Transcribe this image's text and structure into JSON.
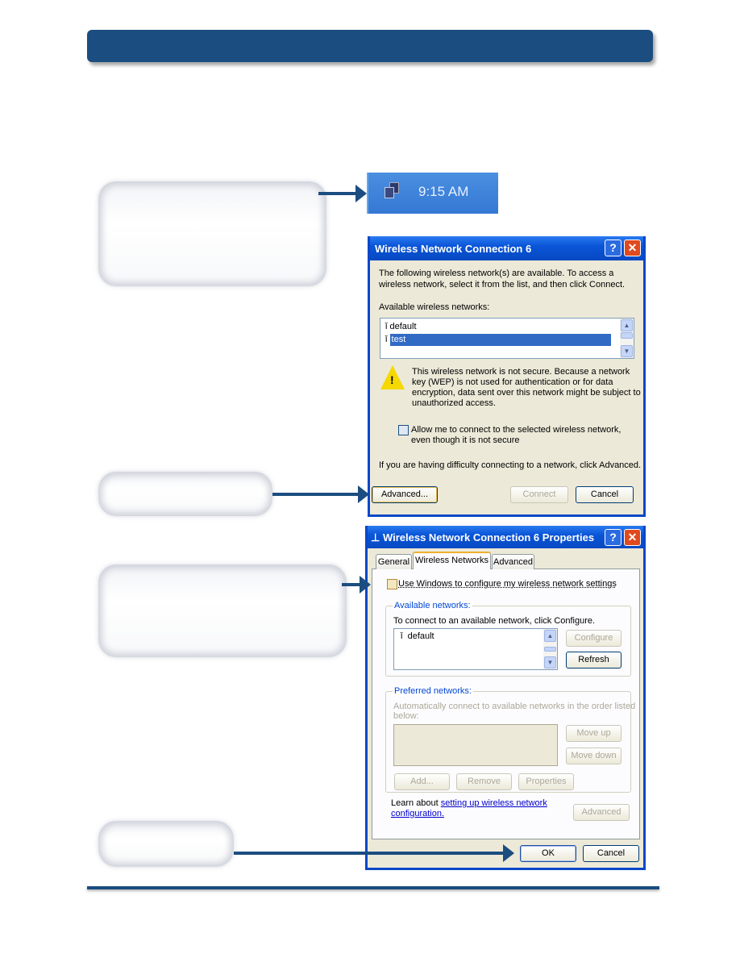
{
  "taskbar": {
    "clock": "9:15 AM",
    "icon": "network-connection-icon",
    "color": "#3478d4"
  },
  "colors": {
    "accent": "#1b4d80",
    "xp_title": "#0a55d8",
    "dialog_bg": "#ece9d8",
    "selection": "#316ac5"
  },
  "dialog1": {
    "title": "Wireless Network Connection 6",
    "intro_line1": "The following wireless network(s) are available. To access a",
    "intro_line2": "wireless network, select it from the list, and then click Connect.",
    "list_label": "Available wireless networks:",
    "networks": [
      {
        "name": "default",
        "selected": false
      },
      {
        "name": "test",
        "selected": true
      }
    ],
    "warning_lines": [
      "This wireless network is not secure. Because a network",
      "key (WEP) is not used for authentication or for data",
      "encryption, data sent over this network might be subject to",
      "unauthorized access."
    ],
    "allow_line1": "Allow me to connect to the selected wireless network,",
    "allow_line2": "even though it is not secure",
    "allow_checked": false,
    "difficulty": "If you are having difficulty connecting to a network, click Advanced.",
    "buttons": {
      "advanced": "Advanced...",
      "connect": "Connect",
      "cancel": "Cancel"
    }
  },
  "dialog2": {
    "title": "Wireless Network Connection 6 Properties",
    "tabs": [
      {
        "label": "General"
      },
      {
        "label": "Wireless Networks",
        "active": true
      },
      {
        "label": "Advanced"
      }
    ],
    "use_windows": "Use Windows to configure my wireless network settings",
    "use_windows_checked": false,
    "available": {
      "legend": "Available networks:",
      "text": "To connect to an available network, click Configure.",
      "networks": [
        "default"
      ],
      "configure": "Configure",
      "refresh": "Refresh"
    },
    "preferred": {
      "legend": "Preferred networks:",
      "text_line1": "Automatically connect to available networks in the order listed",
      "text_line2": "below:",
      "move_up": "Move up",
      "move_down": "Move down",
      "add": "Add...",
      "remove": "Remove",
      "properties": "Properties"
    },
    "learn_prefix": "Learn about ",
    "learn_link1": "setting up wireless network",
    "learn_link2": "configuration.",
    "advanced": "Advanced",
    "ok": "OK",
    "cancel": "Cancel"
  }
}
